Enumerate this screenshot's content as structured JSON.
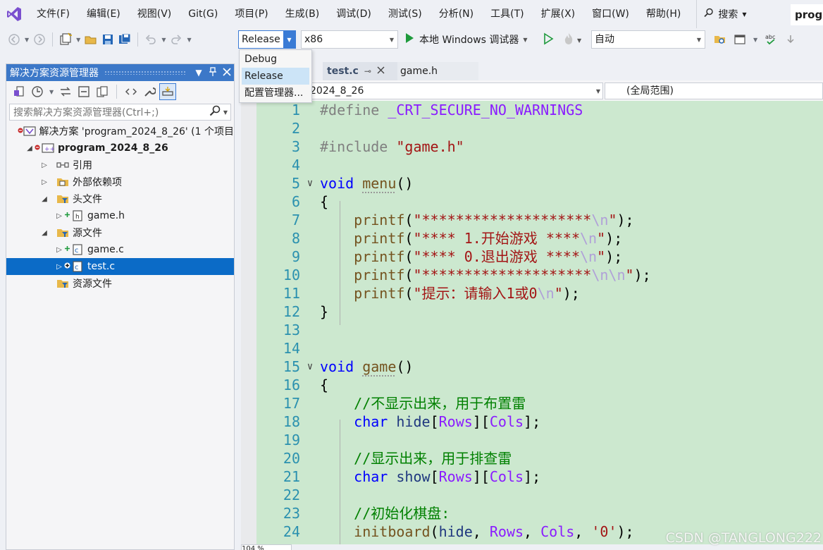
{
  "menubar": {
    "items": [
      "文件(F)",
      "编辑(E)",
      "视图(V)",
      "Git(G)",
      "项目(P)",
      "生成(B)",
      "调试(D)",
      "测试(S)",
      "分析(N)",
      "工具(T)",
      "扩展(X)",
      "窗口(W)",
      "帮助(H)"
    ],
    "search_label": "搜索",
    "title_fragment": "prog"
  },
  "toolbar": {
    "config_value": "Release",
    "platform_value": "x86",
    "debugger_label": "本地 Windows 调试器",
    "startup_value": "自动"
  },
  "config_dropdown": {
    "options": [
      "Debug",
      "Release",
      "配置管理器..."
    ],
    "selected": "Release"
  },
  "solution_explorer": {
    "title": "解决方案资源管理器",
    "search_placeholder": "搜索解决方案资源管理器(Ctrl+;)",
    "tree": [
      {
        "label": "解决方案 'program_2024_8_26' (1 个项目",
        "level": 0,
        "expander": "",
        "kind": "solution"
      },
      {
        "label": "program_2024_8_26",
        "level": 1,
        "expander": "◢",
        "kind": "project",
        "bold": true
      },
      {
        "label": "引用",
        "level": 2,
        "expander": "▷",
        "kind": "references"
      },
      {
        "label": "外部依赖项",
        "level": 2,
        "expander": "▷",
        "kind": "external"
      },
      {
        "label": "头文件",
        "level": 2,
        "expander": "◢",
        "kind": "filter"
      },
      {
        "label": "game.h",
        "level": 3,
        "expander": "▷",
        "kind": "header"
      },
      {
        "label": "源文件",
        "level": 2,
        "expander": "◢",
        "kind": "filter"
      },
      {
        "label": "game.c",
        "level": 3,
        "expander": "▷",
        "kind": "source"
      },
      {
        "label": "test.c",
        "level": 3,
        "expander": "▷",
        "kind": "source",
        "selected": true
      },
      {
        "label": "资源文件",
        "level": 2,
        "expander": "",
        "kind": "filter"
      }
    ]
  },
  "editor": {
    "tabs": [
      {
        "label": "test.c",
        "active": true
      },
      {
        "label": "game.h",
        "active": false
      }
    ],
    "nav_project": "2024_8_26",
    "nav_scope": "(全局范围)",
    "zoom": "104 %",
    "watermark": "CSDN @TANGLONG222"
  },
  "colors": {
    "accent": "#3c78c8",
    "selection": "#0b6bc7",
    "code_background": "#cce8cf",
    "line_number": "#2b91af"
  }
}
